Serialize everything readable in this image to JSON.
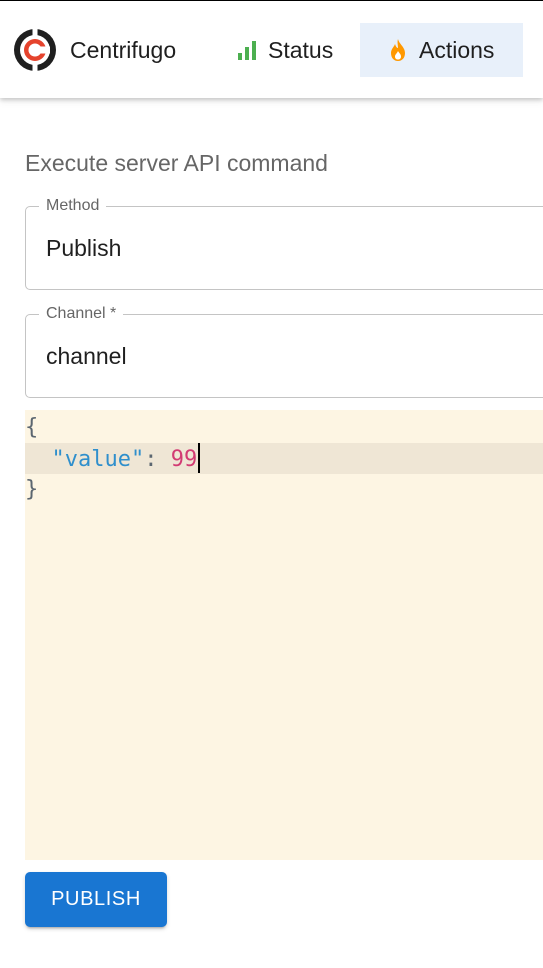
{
  "colors": {
    "accent": "#1976d2",
    "logo_dark": "#1f1f1f",
    "logo_red": "#e5432d",
    "status_icon": "#4caf50",
    "actions_icon": "#ff9800",
    "active_nav_bg": "#e8f0fa",
    "editor_bg": "#fdf5e3"
  },
  "header": {
    "app_name": "Centrifugo",
    "logo_icon": "centrifugo-logo",
    "nav": [
      {
        "label": "Status",
        "icon": "bar-chart-icon",
        "active": false
      },
      {
        "label": "Actions",
        "icon": "flame-icon",
        "active": true
      }
    ]
  },
  "main": {
    "section_title": "Execute server API command",
    "method": {
      "label": "Method",
      "value": "Publish"
    },
    "channel": {
      "label": "Channel *",
      "value": "channel"
    },
    "editor": {
      "open_brace": "{",
      "key": "\"value\"",
      "colon": ": ",
      "value": "99",
      "close_brace": "}"
    },
    "publish_button": "PUBLISH"
  }
}
